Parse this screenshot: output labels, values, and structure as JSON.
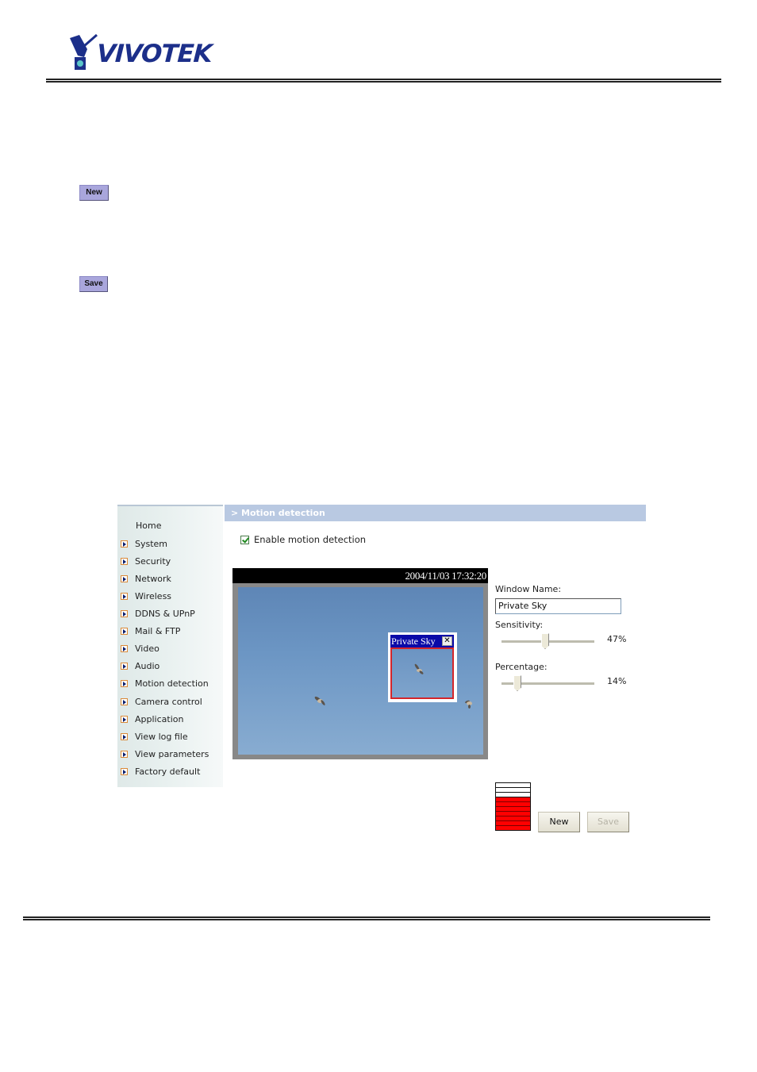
{
  "header": {
    "brand": "VIVOTEK",
    "brand_color": "#1c2f8a"
  },
  "doc_buttons": {
    "new_label": "New",
    "save_label": "Save"
  },
  "screenshot": {
    "title": "> Motion detection",
    "nav": [
      {
        "label": "Home",
        "icon": "none"
      },
      {
        "label": "System",
        "icon": "arrow-right-icon"
      },
      {
        "label": "Security",
        "icon": "arrow-right-icon"
      },
      {
        "label": "Network",
        "icon": "arrow-right-icon"
      },
      {
        "label": "Wireless",
        "icon": "arrow-right-icon"
      },
      {
        "label": "DDNS & UPnP",
        "icon": "arrow-right-icon"
      },
      {
        "label": "Mail & FTP",
        "icon": "arrow-right-icon"
      },
      {
        "label": "Video",
        "icon": "arrow-right-icon"
      },
      {
        "label": "Audio",
        "icon": "arrow-right-icon"
      },
      {
        "label": "Motion detection",
        "icon": "arrow-right-icon"
      },
      {
        "label": "Camera control",
        "icon": "arrow-right-icon"
      },
      {
        "label": "Application",
        "icon": "arrow-right-icon"
      },
      {
        "label": "View log file",
        "icon": "arrow-right-icon"
      },
      {
        "label": "View parameters",
        "icon": "arrow-right-icon"
      },
      {
        "label": "Factory default",
        "icon": "arrow-right-icon"
      }
    ],
    "enable_label": "Enable motion detection",
    "enable_checked": true,
    "timestamp": "2004/11/03 17:32:20",
    "motion_window": {
      "title": "Private Sky",
      "close_glyph": "✕",
      "border_color": "#d4262b",
      "title_bg": "#0a0aa8"
    },
    "settings": {
      "window_name_label": "Window Name:",
      "window_name_value": "Private Sky",
      "sensitivity_label": "Sensitivity:",
      "sensitivity_value": 47,
      "sensitivity_text": "47%",
      "percentage_label": "Percentage:",
      "percentage_value": 14,
      "percentage_text": "14%",
      "level_segments_total": 10,
      "level_segments_active": 7,
      "level_color": "#ff0000",
      "new_label": "New",
      "save_label": "Save",
      "save_enabled": false
    }
  }
}
